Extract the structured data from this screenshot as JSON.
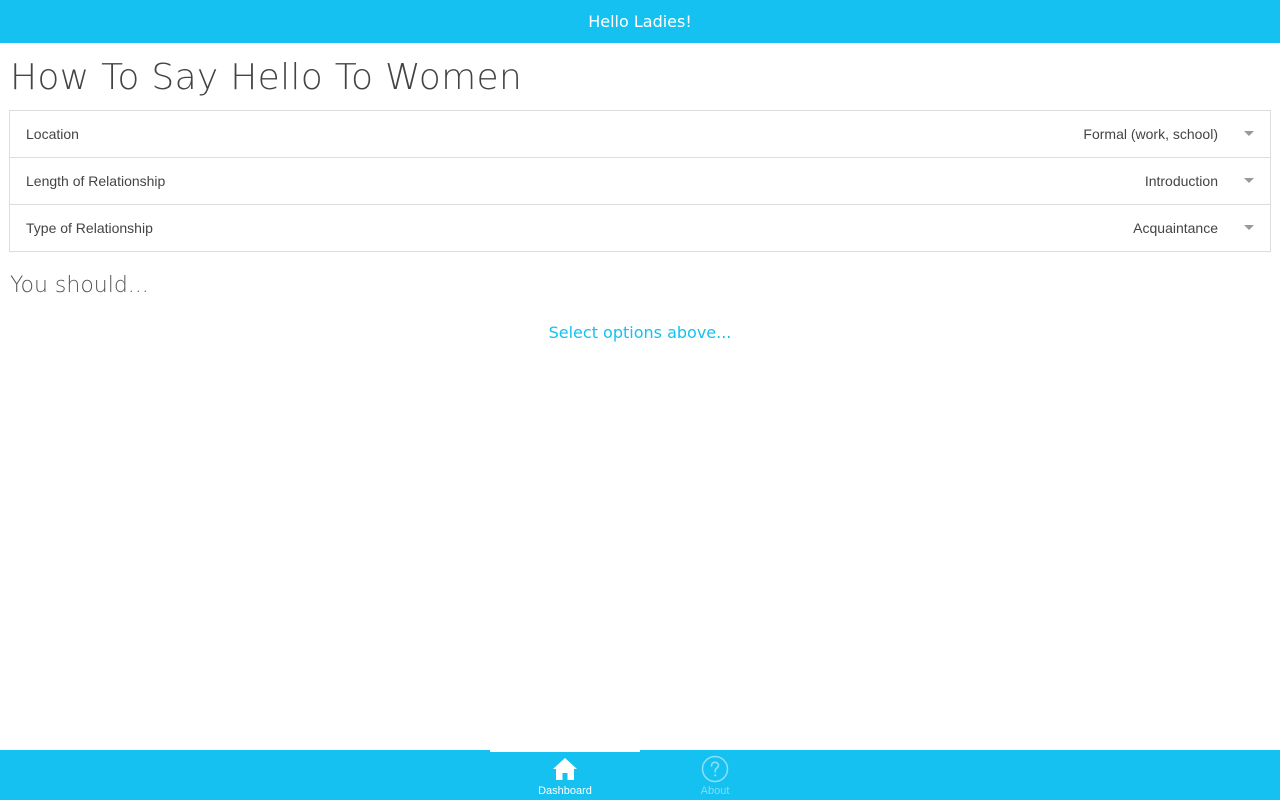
{
  "header": {
    "title": "Hello Ladies!"
  },
  "main": {
    "title": "How To Say Hello To Women",
    "options": [
      {
        "label": "Location",
        "value": "Formal (work, school)"
      },
      {
        "label": "Length of Relationship",
        "value": "Introduction"
      },
      {
        "label": "Type of Relationship",
        "value": "Acquaintance"
      }
    ],
    "result_heading": "You should...",
    "result_hint": "Select options above..."
  },
  "tabs": [
    {
      "label": "Dashboard",
      "icon": "home-icon",
      "active": true
    },
    {
      "label": "About",
      "icon": "help-circle-icon",
      "active": false
    }
  ],
  "colors": {
    "accent": "#14c1f1",
    "text": "#444444",
    "border": "#dddddd"
  }
}
